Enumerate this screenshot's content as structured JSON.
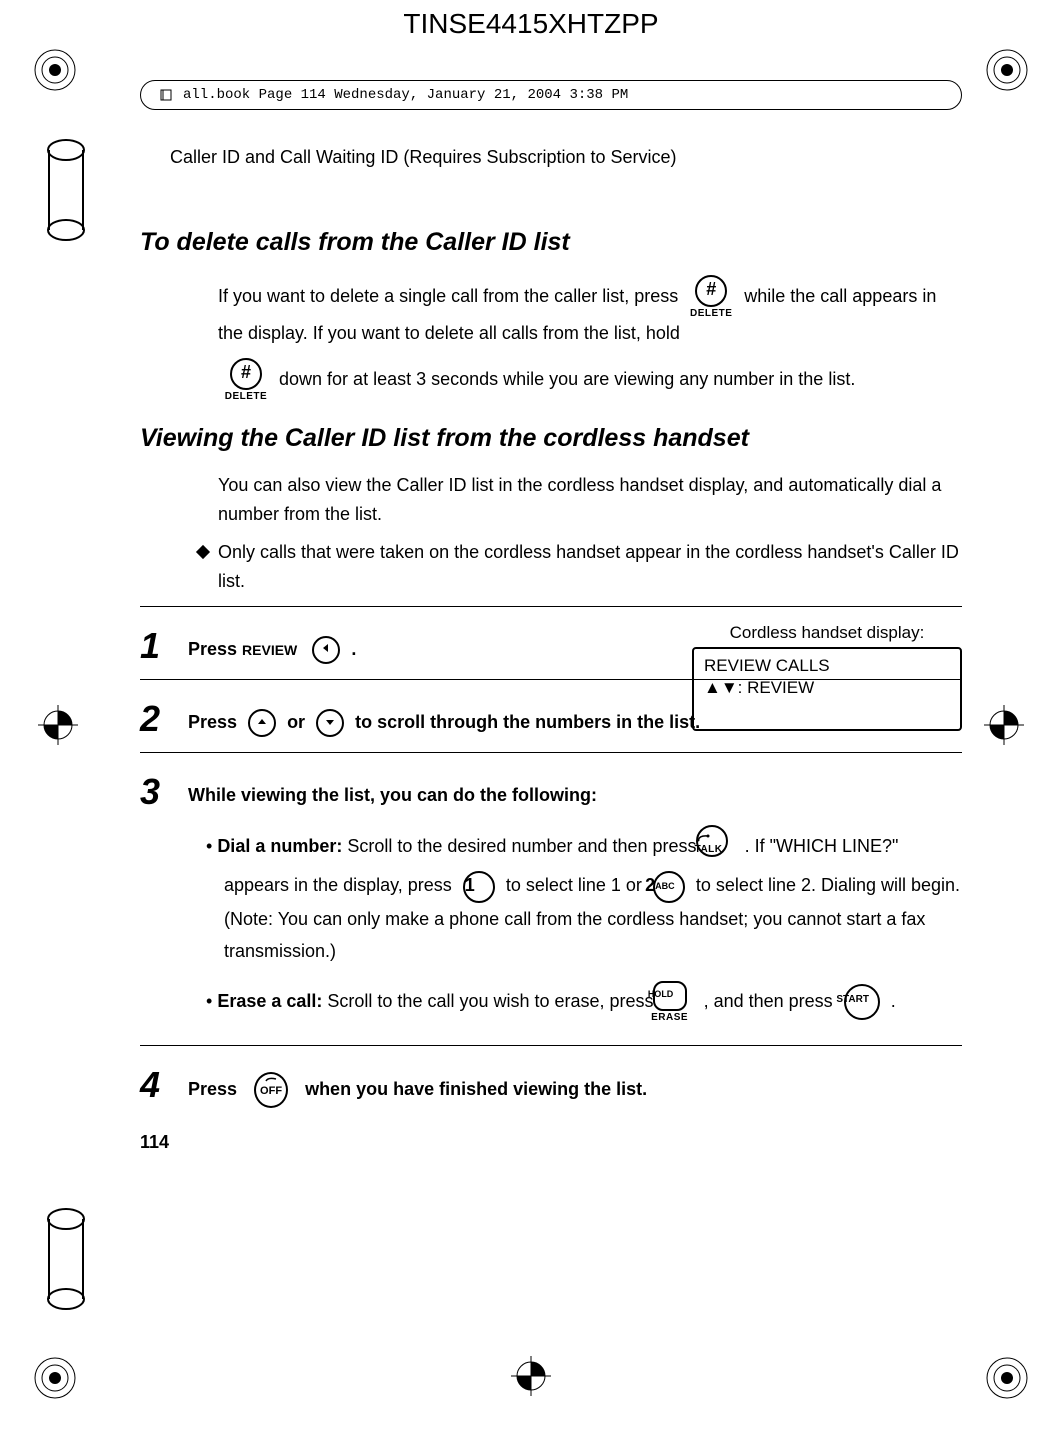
{
  "header_code": "TINSE4415XHTZPP",
  "print_meta": "all.book  Page 114  Wednesday, January 21, 2004  3:38 PM",
  "running_head": "Caller ID and Call Waiting ID (Requires Subscription to Service)",
  "section1": {
    "title": "To delete calls from the Caller ID list",
    "para_a": "If you want to delete a single call from the caller list, press ",
    "para_b": " while the call appears in the display. If you want to delete all calls from the list, hold ",
    "para_c": " down for at least 3 seconds while you are viewing any number in the list."
  },
  "key_hash": {
    "glyph": "#",
    "sublabel": "DELETE"
  },
  "section2": {
    "title": "Viewing the Caller ID list from the cordless handset",
    "p1": "You can also view the Caller ID list in the cordless handset display, and automatically dial a number from the list.",
    "bullet": "Only calls that were taken on the cordless handset appear in the cordless handset's Caller ID list."
  },
  "steps": {
    "1": {
      "n": "1",
      "pre": "Press ",
      "review_label": "REVIEW",
      "post": " .",
      "display_caption": "Cordless handset display:",
      "lcd_line1": "REVIEW CALLS",
      "lcd_line2": "▲▼: REVIEW"
    },
    "2": {
      "n": "2",
      "pre": "Press ",
      "mid": " or ",
      "post": " to scroll through the numbers in the list."
    },
    "3": {
      "n": "3",
      "lead": "While viewing the list, you can do the following:",
      "dial": {
        "label": "Dial a number:",
        "a": " Scroll to the desired number and then press ",
        "b": " . If \"WHICH LINE?\" appears in the display, press ",
        "c": " to select line 1 or ",
        "d": " to select line 2. Dialing will begin. (Note: You can only make a phone call from the cordless handset; you cannot start a fax transmission.)"
      },
      "erase": {
        "label": "Erase a call:",
        "a": " Scroll to the call you wish to erase, press ",
        "b": " , and then press ",
        "c": " ."
      }
    },
    "4": {
      "n": "4",
      "pre": "Press ",
      "post": " when you have finished viewing the list."
    }
  },
  "keys": {
    "talk_sub": "TALK",
    "hold": "HOLD",
    "erase_sub": "ERASE",
    "start": "START",
    "off": "OFF",
    "one": "1",
    "two": "2",
    "two_abc": "ABC"
  },
  "pagenum": "114"
}
